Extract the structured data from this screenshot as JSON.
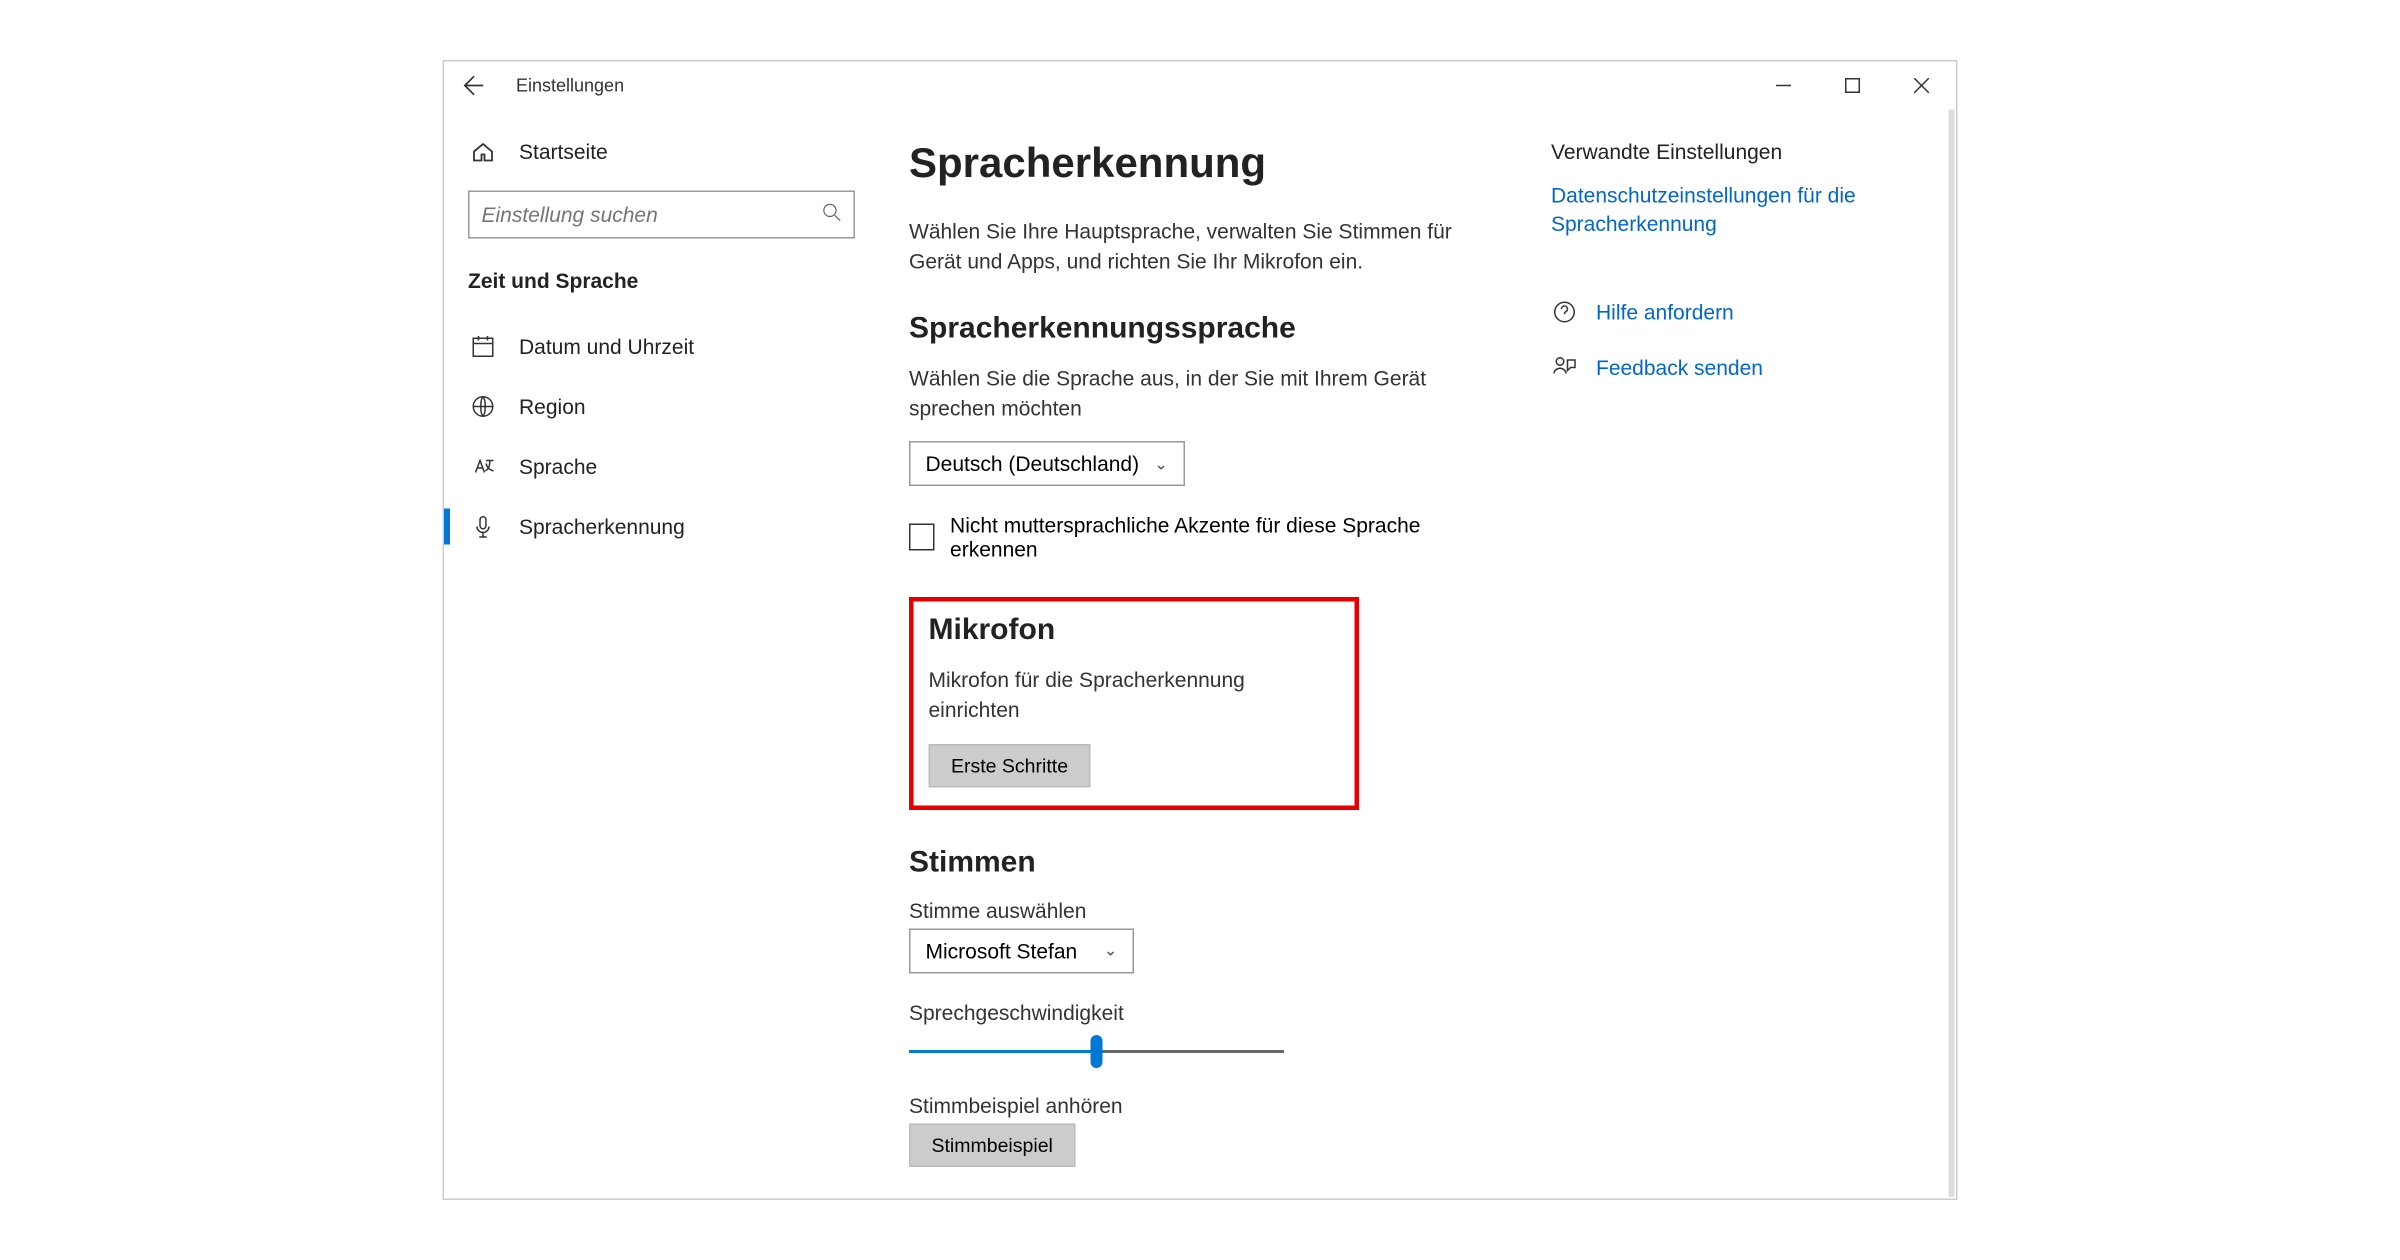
{
  "window": {
    "title": "Einstellungen"
  },
  "sidebar": {
    "home": "Startseite",
    "search_placeholder": "Einstellung suchen",
    "category": "Zeit und Sprache",
    "items": [
      {
        "label": "Datum und Uhrzeit"
      },
      {
        "label": "Region"
      },
      {
        "label": "Sprache"
      },
      {
        "label": "Spracherkennung"
      }
    ]
  },
  "main": {
    "title": "Spracherkennung",
    "intro": "Wählen Sie Ihre Hauptsprache, verwalten Sie Stimmen für Gerät und Apps, und richten Sie Ihr Mikrofon ein.",
    "lang_section": {
      "heading": "Spracherkennungssprache",
      "desc": "Wählen Sie die Sprache aus, in der Sie mit Ihrem Gerät sprechen möchten",
      "selected": "Deutsch (Deutschland)",
      "checkbox": "Nicht muttersprachliche Akzente für diese Sprache erkennen"
    },
    "mic_section": {
      "heading": "Mikrofon",
      "desc": "Mikrofon für die Spracherkennung einrichten",
      "button": "Erste Schritte"
    },
    "voices_section": {
      "heading": "Stimmen",
      "select_label": "Stimme auswählen",
      "selected_voice": "Microsoft Stefan",
      "speed_label": "Sprechgeschwindigkeit",
      "sample_label": "Stimmbeispiel anhören",
      "sample_button": "Stimmbeispiel"
    }
  },
  "aside": {
    "related_heading": "Verwandte Einstellungen",
    "related_link": "Datenschutzeinstellungen für die Spracherkennung",
    "help": "Hilfe anfordern",
    "feedback": "Feedback senden"
  }
}
